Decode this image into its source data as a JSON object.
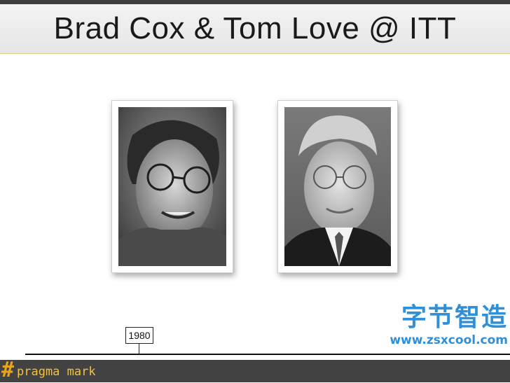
{
  "slide": {
    "title": "Brad Cox & Tom Love @ ITT"
  },
  "photos": [
    {
      "subject": "Brad Cox",
      "style": "black-and-white portrait"
    },
    {
      "subject": "Tom Love",
      "style": "black-and-white portrait"
    }
  ],
  "timeline": {
    "year_label": "1980"
  },
  "watermark": {
    "chinese_text": "字节智造",
    "url": "www.zsxcool.com",
    "color": "#2f8fd8"
  },
  "footer": {
    "hash": "#",
    "text": "pragma mark",
    "accent_color": "#f2c23a",
    "background": "#424242"
  }
}
